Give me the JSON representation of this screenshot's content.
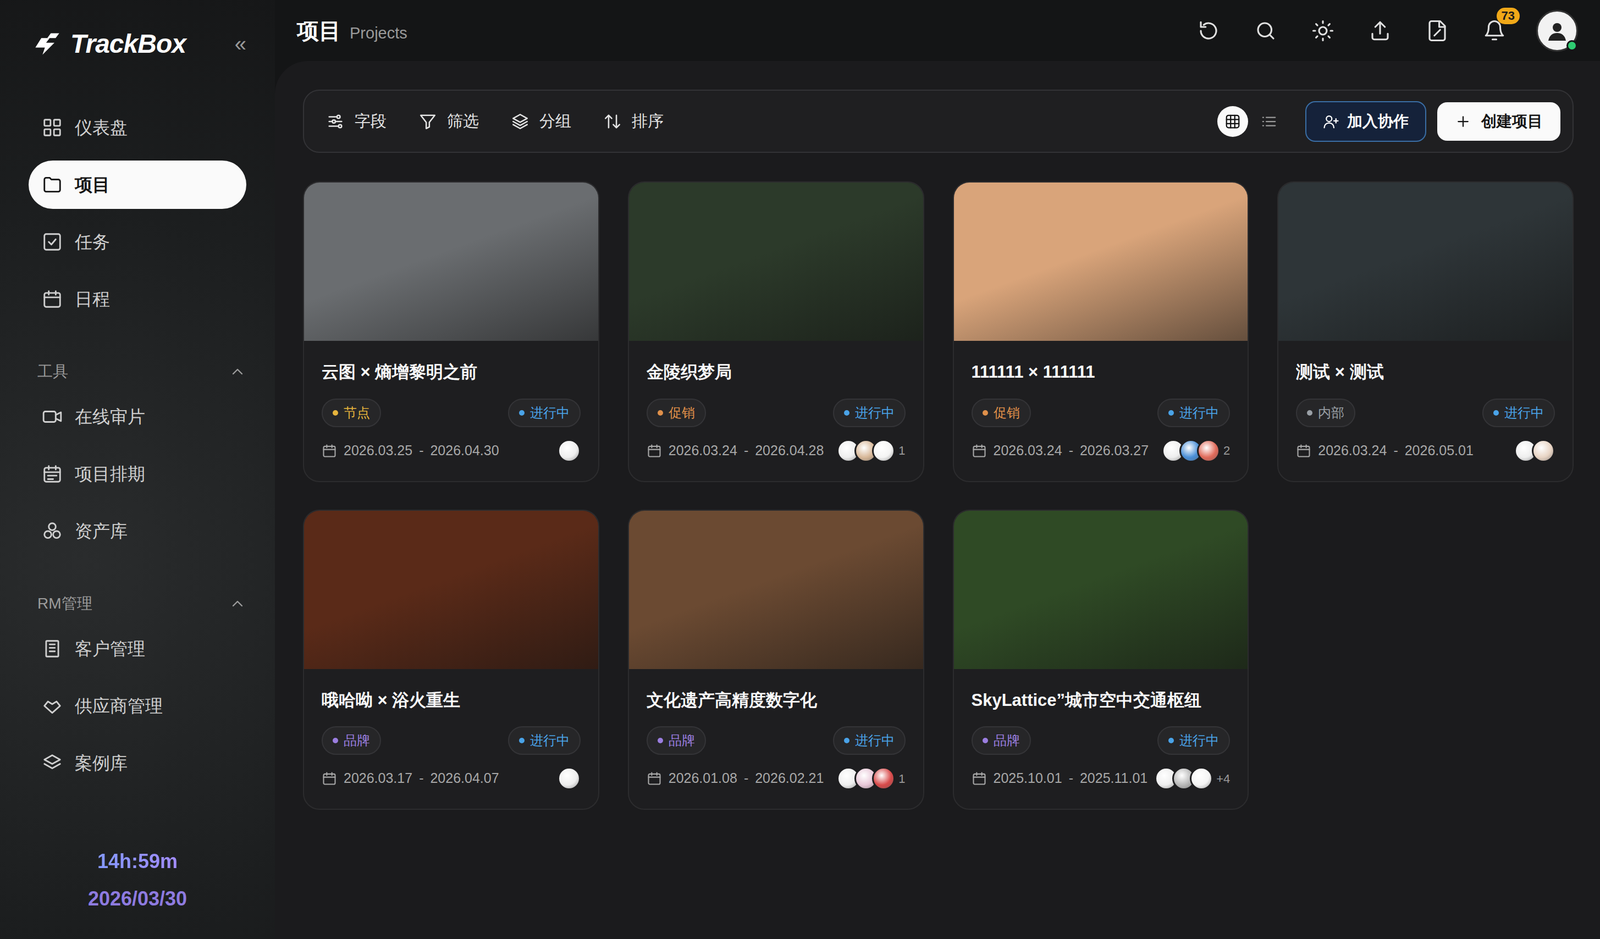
{
  "app": {
    "logo": "TrackBox",
    "collapse_icon": "«"
  },
  "header": {
    "title": "项目",
    "subtitle": "Projects",
    "notification_count": "73",
    "online": true
  },
  "sidebar": {
    "items": [
      {
        "label": "仪表盘",
        "selected": false
      },
      {
        "label": "项目",
        "selected": true
      },
      {
        "label": "任务",
        "selected": false
      },
      {
        "label": "日程",
        "selected": false
      }
    ],
    "sections": [
      {
        "title": "工具",
        "expanded": true,
        "items": [
          {
            "label": "在线审片",
            "selected": false
          },
          {
            "label": "项目排期",
            "selected": false
          },
          {
            "label": "资产库",
            "selected": false
          }
        ]
      },
      {
        "title": "RM管理",
        "expanded": true,
        "items": [
          {
            "label": "客户管理",
            "selected": false
          },
          {
            "label": "供应商管理",
            "selected": false
          },
          {
            "label": "案例库",
            "selected": false
          }
        ]
      }
    ],
    "timer": "14h:59m",
    "date": "2026/03/30"
  },
  "toolbar": {
    "tools": [
      "字段",
      "筛选",
      "分组",
      "排序"
    ],
    "views": [
      {
        "kind": "grid",
        "selected": true
      },
      {
        "kind": "list",
        "selected": false
      }
    ],
    "join_button": "加入协作",
    "create_button": "创建项目"
  },
  "projects": [
    {
      "title": "云图 × 熵增黎明之前",
      "cover": "#6a6d70",
      "tag": {
        "label": "节点",
        "color": "#e6b43c"
      },
      "status": {
        "label": "进行中",
        "color": "#4aa3e8"
      },
      "start": "2026.03.25",
      "separator": "-",
      "end": "2026.04.30",
      "members": [
        "#eeeeee"
      ]
    },
    {
      "title": "金陵织梦局",
      "cover": "#2c3a2a",
      "tag": {
        "label": "促销",
        "color": "#e0904a"
      },
      "status": {
        "label": "进行中",
        "color": "#4aa3e8"
      },
      "start": "2026.03.24",
      "separator": "-",
      "end": "2026.04.28",
      "members": [
        "#eeeeee",
        "#d8b899",
        "#f4f4f4"
      ],
      "more": "1"
    },
    {
      "title": "111111 × 111111",
      "cover": "#d9a47a",
      "tag": {
        "label": "促销",
        "color": "#e0904a"
      },
      "status": {
        "label": "进行中",
        "color": "#4aa3e8"
      },
      "start": "2026.03.24",
      "separator": "-",
      "end": "2026.03.27",
      "members": [
        "#eeeeee",
        "#4a8fd8",
        "#e06a5a"
      ],
      "more": "2"
    },
    {
      "title": "测试 × 测试",
      "cover": "#2e3538",
      "tag": {
        "label": "内部",
        "color": "#9aa0a6"
      },
      "status": {
        "label": "进行中",
        "color": "#4aa3e8"
      },
      "start": "2026.03.24",
      "separator": "-",
      "end": "2026.05.01",
      "members": [
        "#eeeeee",
        "#e8d4c4"
      ]
    },
    {
      "title": "哦哈呦 × 浴火重生",
      "cover": "#5a2a18",
      "tag": {
        "label": "品牌",
        "color": "#9b7ee0"
      },
      "status": {
        "label": "进行中",
        "color": "#4aa3e8"
      },
      "start": "2026.03.17",
      "separator": "-",
      "end": "2026.04.07",
      "members": [
        "#eeeeee"
      ]
    },
    {
      "title": "文化遗产高精度数字化",
      "cover": "#6b4a32",
      "tag": {
        "label": "品牌",
        "color": "#9b7ee0"
      },
      "status": {
        "label": "进行中",
        "color": "#4aa3e8"
      },
      "start": "2026.01.08",
      "separator": "-",
      "end": "2026.02.21",
      "members": [
        "#eeeeee",
        "#e8c8d8",
        "#d84a4a"
      ],
      "more": "1"
    },
    {
      "title": "SkyLattice”城市空中交通枢纽",
      "cover": "#2f4a25",
      "tag": {
        "label": "品牌",
        "color": "#9b7ee0"
      },
      "status": {
        "label": "进行中",
        "color": "#4aa3e8"
      },
      "start": "2025.10.01",
      "separator": "-",
      "end": "2025.11.01",
      "members": [
        "#eeeeee",
        "#b8b8b8",
        "#f4f4f4"
      ],
      "more": "+4"
    }
  ]
}
